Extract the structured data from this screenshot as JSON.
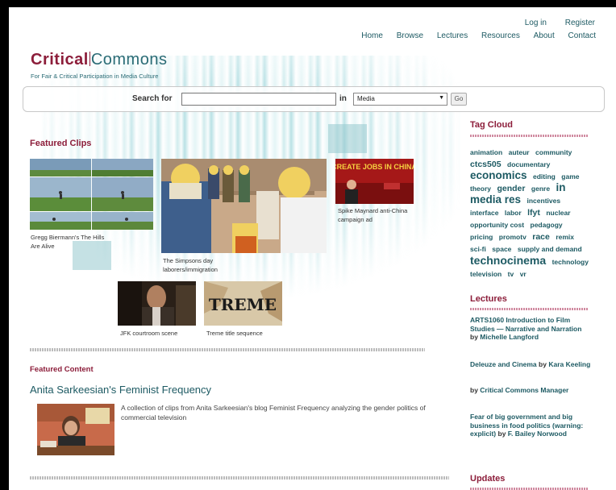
{
  "header": {
    "util_links": [
      "Log in",
      "Register"
    ],
    "nav": [
      "Home",
      "Browse",
      "Lectures",
      "Resources",
      "About",
      "Contact"
    ],
    "logo_critical": "Critical",
    "logo_commons": "Commons",
    "tagline": "For Fair & Critical Participation in Media Culture"
  },
  "search": {
    "label": "Search for",
    "in_label": "in",
    "select_value": "Media",
    "go_label": "Go"
  },
  "featured_clips": {
    "title": "Featured Clips",
    "clips": [
      {
        "caption": "Gregg Biermann's The Hills Are Alive"
      },
      {
        "caption": "The Simpsons day laborers/immigration"
      },
      {
        "caption": "Spike Maynard anti-China campaign ad",
        "poster_text": "CREATE JOBS IN CHINA"
      },
      {
        "caption": "JFK courtroom scene"
      },
      {
        "caption": "Treme title sequence",
        "poster_text": "TREME"
      }
    ]
  },
  "featured_content": {
    "section_title": "Featured Content",
    "title": "Anita Sarkeesian's Feminist Frequency",
    "description": "A collection of clips from Anita Sarkeesian's blog Feminist Frequency analyzing the gender politics of commercial television"
  },
  "sidebar": {
    "tag_cloud_title": "Tag Cloud",
    "tags": [
      {
        "text": "animation",
        "size": 1
      },
      {
        "text": "auteur",
        "size": 1
      },
      {
        "text": "community",
        "size": 1
      },
      {
        "text": "ctcs505",
        "size": 2
      },
      {
        "text": "documentary",
        "size": 1
      },
      {
        "text": "economics",
        "size": 3
      },
      {
        "text": "editing",
        "size": 1
      },
      {
        "text": "game",
        "size": 1
      },
      {
        "text": "theory",
        "size": 1
      },
      {
        "text": "gender",
        "size": 2
      },
      {
        "text": "genre",
        "size": 1
      },
      {
        "text": "in",
        "size": 3
      },
      {
        "text": "media res",
        "size": 3
      },
      {
        "text": "incentives",
        "size": 1
      },
      {
        "text": "interface",
        "size": 1
      },
      {
        "text": "labor",
        "size": 1
      },
      {
        "text": "lfyt",
        "size": 2
      },
      {
        "text": "nuclear",
        "size": 1
      },
      {
        "text": "opportunity cost",
        "size": 1
      },
      {
        "text": "pedagogy",
        "size": 1
      },
      {
        "text": "pricing",
        "size": 1
      },
      {
        "text": "promotv",
        "size": 1
      },
      {
        "text": "race",
        "size": 2
      },
      {
        "text": "remix",
        "size": 1
      },
      {
        "text": "sci-fi",
        "size": 1
      },
      {
        "text": "space",
        "size": 1
      },
      {
        "text": "supply and demand",
        "size": 1
      },
      {
        "text": "technocinema",
        "size": 4
      },
      {
        "text": "technology",
        "size": 1
      },
      {
        "text": "television",
        "size": 1
      },
      {
        "text": "tv",
        "size": 1
      },
      {
        "text": "vr",
        "size": 1
      }
    ],
    "lectures_title": "Lectures",
    "lectures": [
      {
        "title": "ARTS1060 Introduction to Film Studies — Narrative and Narration",
        "by": "by",
        "author": "Michelle Langford"
      },
      {
        "title": "Deleuze and Cinema",
        "by": "by",
        "author": "Kara Keeling"
      },
      {
        "title": "",
        "by": "by",
        "author": "Critical Commons Manager"
      },
      {
        "title": "Fear of big government and big business in food politics (warning: explicit)",
        "by": "by",
        "author": "F. Bailey Norwood"
      }
    ],
    "updates_title": "Updates"
  },
  "colors": {
    "brand": "#8c1d3a",
    "link": "#1d5a63",
    "accent": "#2a6b75"
  }
}
